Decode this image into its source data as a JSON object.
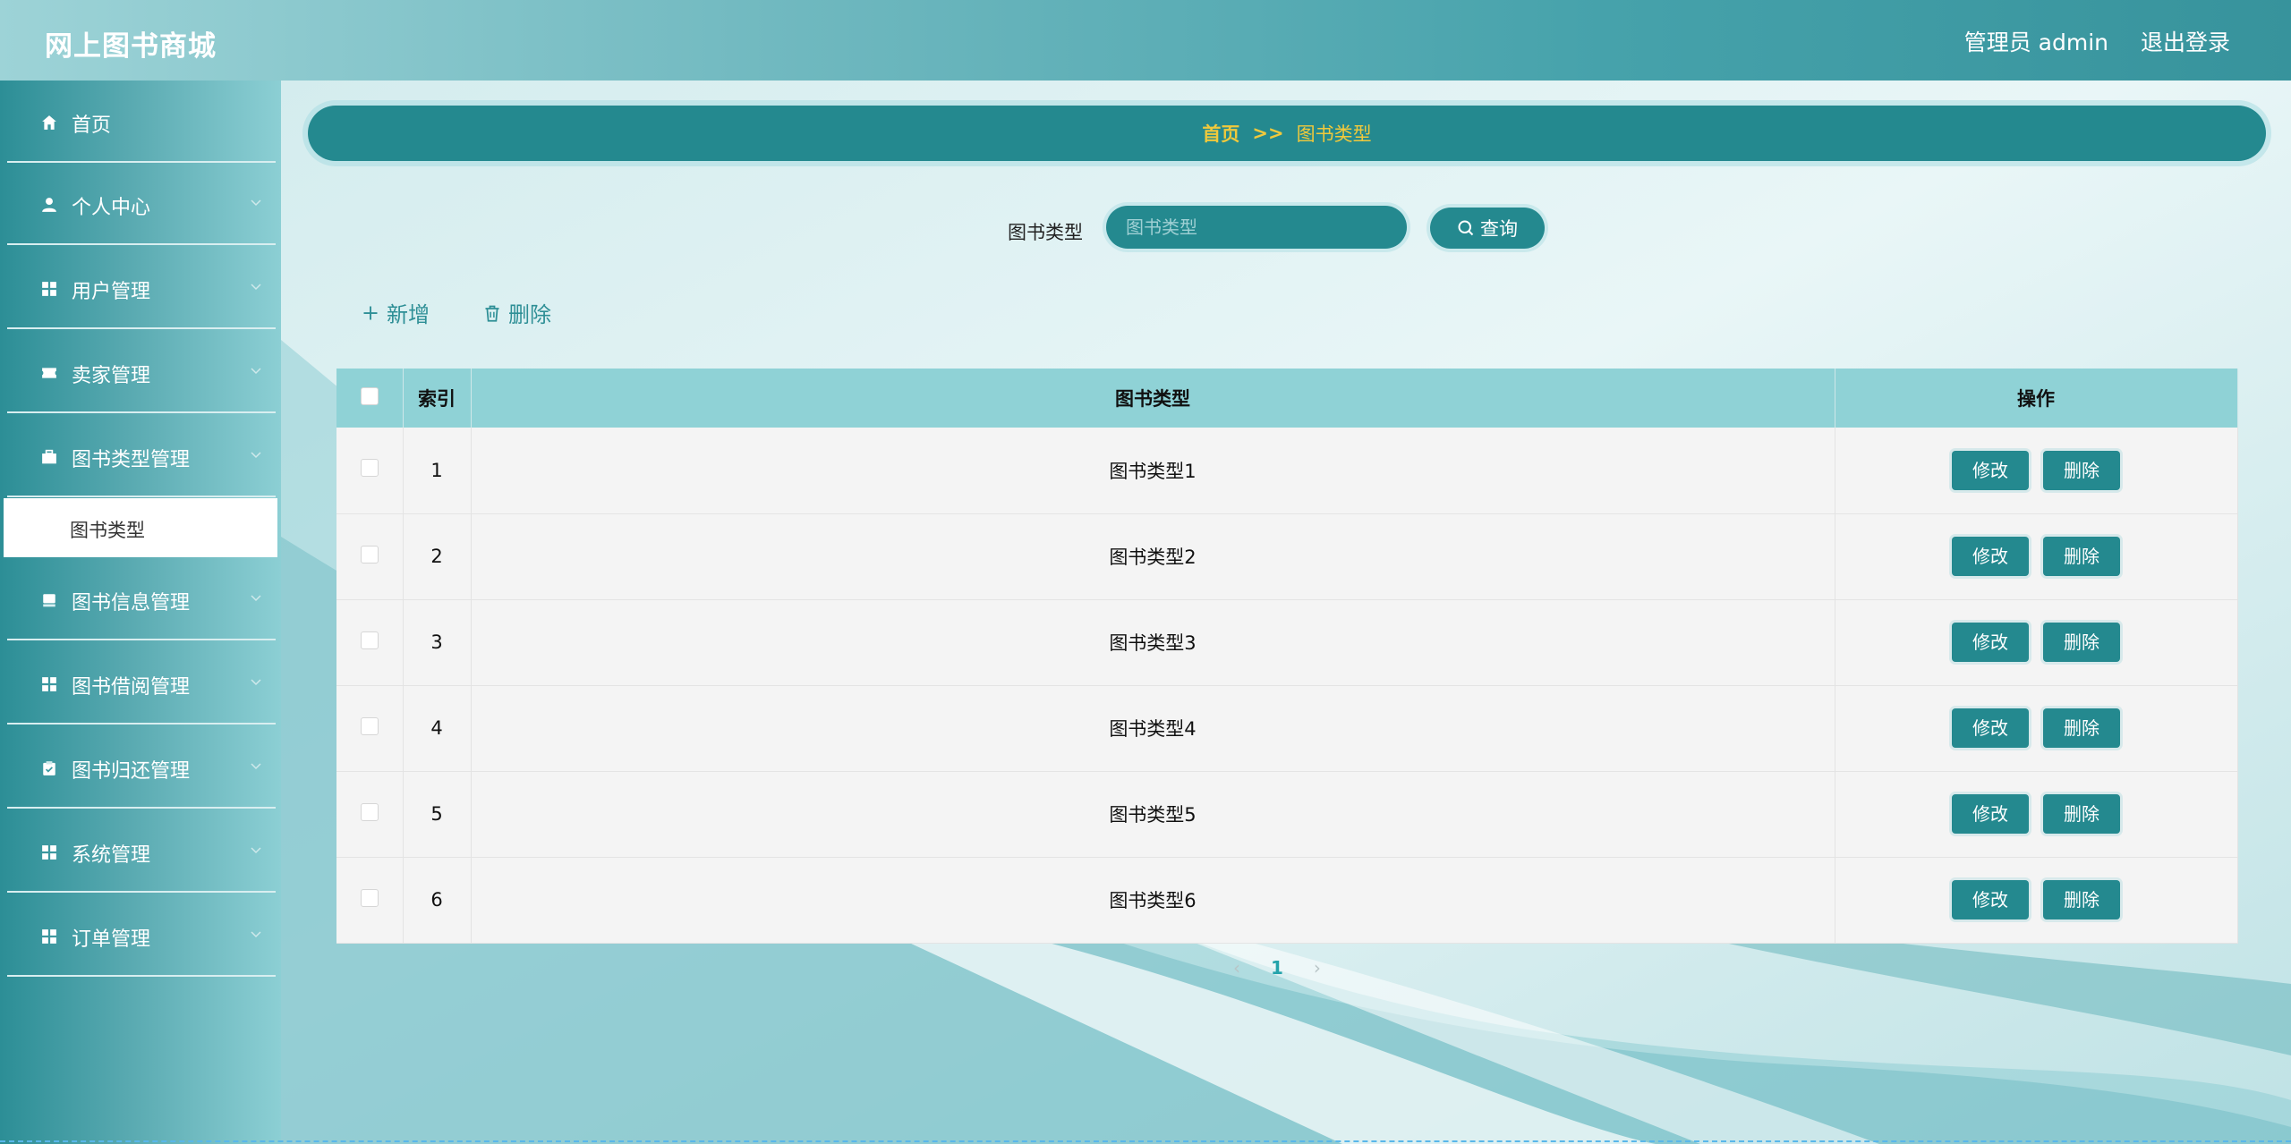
{
  "header": {
    "brand": "网上图书商城",
    "user": "管理员 admin",
    "logout": "退出登录"
  },
  "sidebar": {
    "items": [
      {
        "label": "首页",
        "icon": "home-icon"
      },
      {
        "label": "个人中心",
        "icon": "user-icon"
      },
      {
        "label": "用户管理",
        "icon": "grid-icon"
      },
      {
        "label": "卖家管理",
        "icon": "ticket-icon"
      },
      {
        "label": "图书类型管理",
        "icon": "briefcase-icon"
      },
      {
        "label": "图书信息管理",
        "icon": "book-icon"
      },
      {
        "label": "图书借阅管理",
        "icon": "grid-icon"
      },
      {
        "label": "图书归还管理",
        "icon": "clipboard-icon"
      },
      {
        "label": "系统管理",
        "icon": "grid-icon"
      },
      {
        "label": "订单管理",
        "icon": "grid-icon"
      }
    ],
    "active_sub": "图书类型"
  },
  "breadcrumb": {
    "home": "首页",
    "sep": ">>",
    "current": "图书类型"
  },
  "search": {
    "label": "图书类型",
    "placeholder": "图书类型",
    "button": "查询"
  },
  "toolbar": {
    "add": "新增",
    "delete": "删除"
  },
  "table": {
    "headers": [
      "索引",
      "图书类型",
      "操作"
    ],
    "rows": [
      {
        "index": "1",
        "type": "图书类型1"
      },
      {
        "index": "2",
        "type": "图书类型2"
      },
      {
        "index": "3",
        "type": "图书类型3"
      },
      {
        "index": "4",
        "type": "图书类型4"
      },
      {
        "index": "5",
        "type": "图书类型5"
      },
      {
        "index": "6",
        "type": "图书类型6"
      }
    ],
    "edit_label": "修改",
    "delete_label": "删除"
  },
  "pagination": {
    "current": "1"
  },
  "colors": {
    "primary": "#24898f",
    "breadcrumb_text": "#f0c93c",
    "table_header": "#8fd2d6"
  }
}
